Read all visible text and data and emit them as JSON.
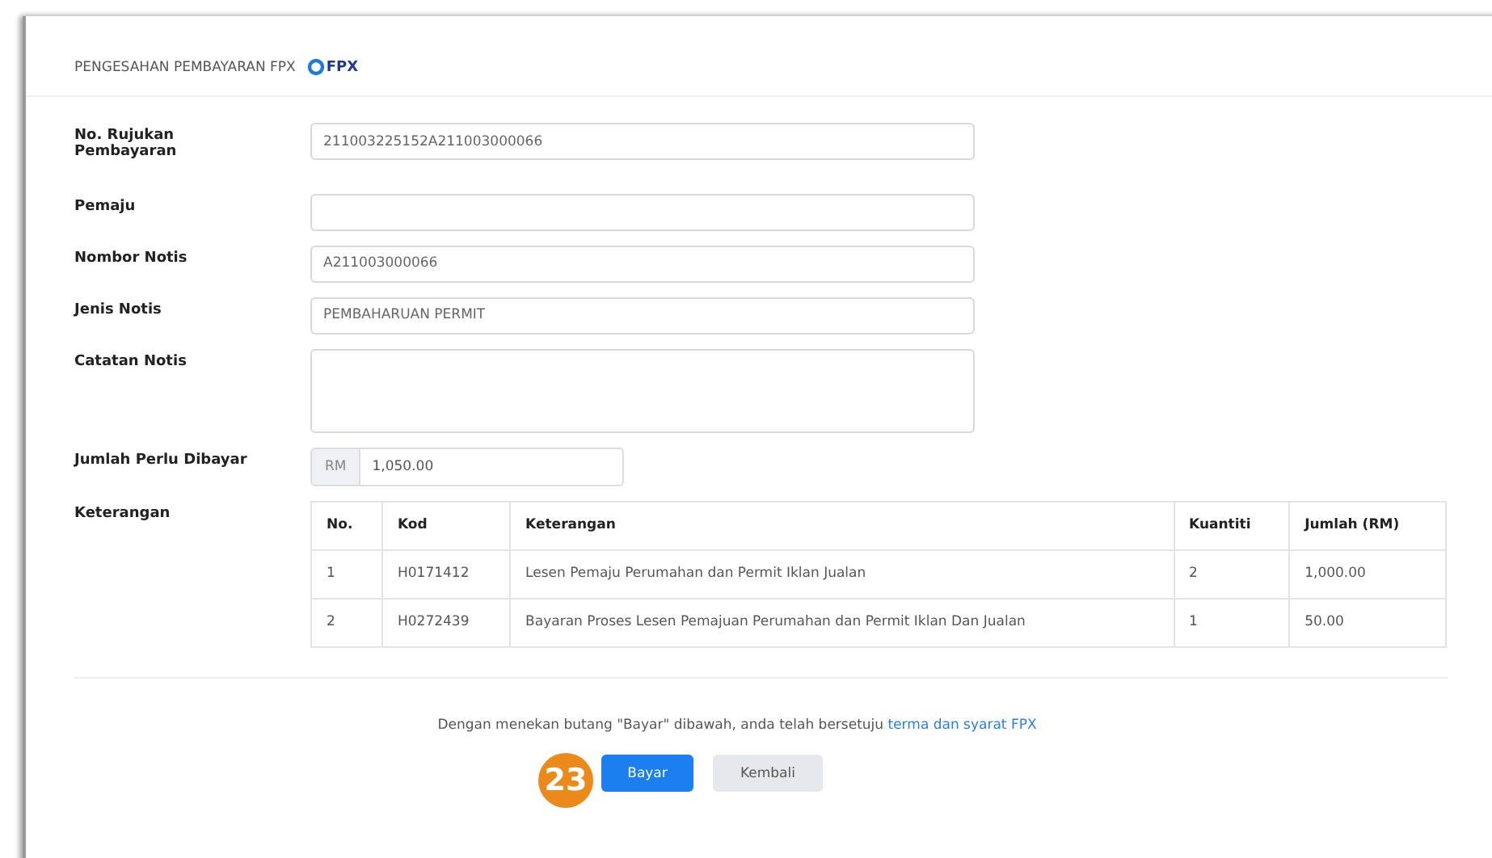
{
  "header": {
    "title": "PENGESAHAN PEMBAYARAN FPX",
    "logo_text": "FPX"
  },
  "fields": [
    {
      "label": "No. Rujukan Pembayaran",
      "value": "211003225152A211003000066",
      "kind": "text"
    },
    {
      "label": "Pemaju",
      "kind": "text"
    },
    {
      "label": "Nombor Notis",
      "value": "A211003000066",
      "kind": "text"
    },
    {
      "label": "Jenis Notis",
      "value": "PEMBAHARUAN PERMIT",
      "kind": "text"
    },
    {
      "label": "Catatan Notis",
      "kind": "textarea"
    },
    {
      "label": "Jumlah Perlu Dibayar",
      "prefix": "RM",
      "value": "1,050.00",
      "kind": "amount"
    }
  ],
  "details": {
    "label": "Keterangan",
    "columns": [
      "No.",
      "Kod",
      "Keterangan",
      "Kuantiti",
      "Jumlah (RM)"
    ],
    "rows": [
      [
        "1",
        "H0171412",
        "Lesen Pemaju Perumahan dan Permit Iklan Jualan",
        "2",
        "1,000.00"
      ],
      [
        "2",
        "H0272439",
        "Bayaran Proses Lesen Pemajuan Perumahan dan Permit Iklan Dan Jualan",
        "1",
        "50.00"
      ]
    ]
  },
  "agreement": {
    "text": "Dengan menekan butang \"Bayar\" dibawah, anda telah bersetuju",
    "link": "terma dan syarat FPX"
  },
  "step_badge": "23",
  "buttons": [
    {
      "label": "Bayar",
      "kind": "primary"
    },
    {
      "label": "Kembali",
      "kind": "secondary"
    }
  ]
}
